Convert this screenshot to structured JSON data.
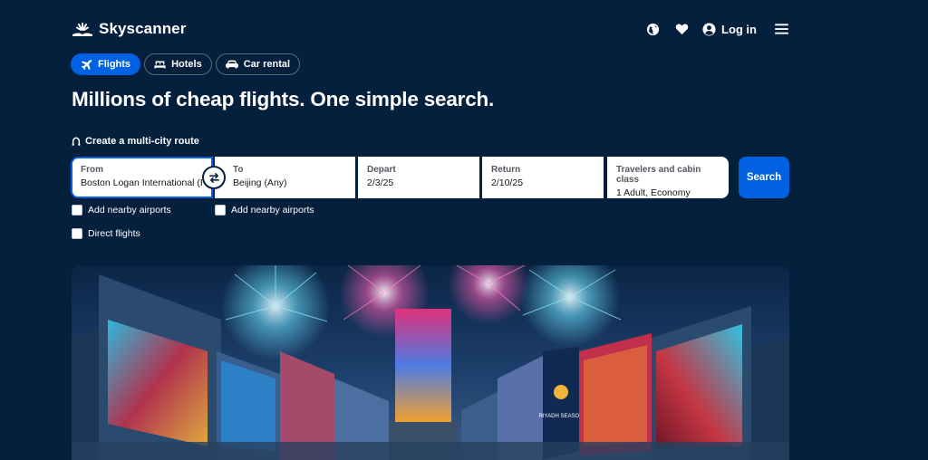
{
  "brand": {
    "name": "Skyscanner",
    "logo_icon": "sunrise-logo-icon"
  },
  "header": {
    "region_icon": "globe-icon",
    "saved_icon": "heart-icon",
    "user_icon": "user-circle-icon",
    "login_label": "Log in",
    "menu_icon": "hamburger-menu-icon"
  },
  "tabs": [
    {
      "label": "Flights",
      "icon": "plane-icon",
      "active": true
    },
    {
      "label": "Hotels",
      "icon": "bed-icon",
      "active": false
    },
    {
      "label": "Car rental",
      "icon": "car-icon",
      "active": false
    }
  ],
  "headline": "Millions of cheap flights. One simple search.",
  "multicity_label": "Create a multi-city route",
  "search": {
    "from": {
      "label": "From",
      "value": "Boston Logan International (BOS)"
    },
    "to": {
      "label": "To",
      "value": "Beijing (Any)"
    },
    "depart": {
      "label": "Depart",
      "value": "2/3/25"
    },
    "return": {
      "label": "Return",
      "value": "2/10/25"
    },
    "travelers": {
      "label": "Travelers and cabin class",
      "value": "1 Adult, Economy"
    },
    "button_label": "Search",
    "swap_icon": "swap-arrows-icon"
  },
  "options": {
    "nearby_from": "Add nearby airports",
    "nearby_to": "Add nearby airports",
    "direct": "Direct flights"
  },
  "hero": {
    "description_icon": "fireworks-city-hero-image",
    "sign_text": "RIYADH SEASON"
  },
  "colors": {
    "background": "#05203c",
    "accent": "#0062e3",
    "white": "#ffffff"
  }
}
